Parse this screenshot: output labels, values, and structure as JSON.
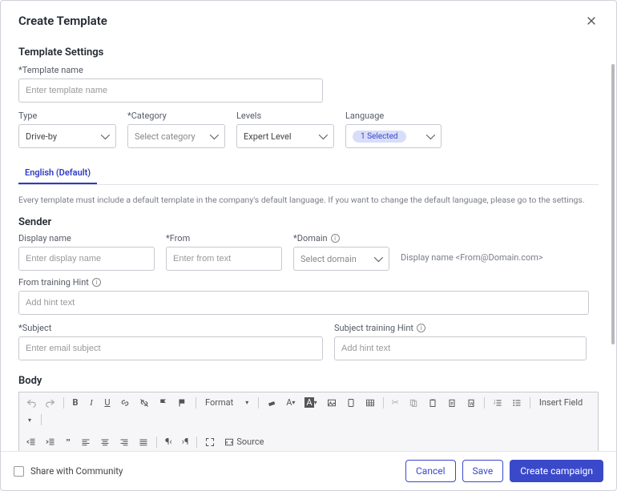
{
  "header": {
    "title": "Create Template"
  },
  "sections": {
    "settings_title": "Template Settings",
    "sender_title": "Sender",
    "body_title": "Body"
  },
  "fields": {
    "template_name": {
      "label": "*Template name",
      "placeholder": "Enter template name"
    },
    "type": {
      "label": "Type",
      "value": "Drive-by"
    },
    "category": {
      "label": "*Category",
      "placeholder": "Select category"
    },
    "levels": {
      "label": "Levels",
      "value": "Expert Level"
    },
    "language": {
      "label": "Language",
      "selected_pill": "1 Selected"
    },
    "display_name": {
      "label": "Display name",
      "placeholder": "Enter display name"
    },
    "from": {
      "label": "*From",
      "placeholder": "Enter from text"
    },
    "domain": {
      "label": "*Domain",
      "placeholder": "Select domain"
    },
    "from_hint": {
      "label": "From training Hint",
      "placeholder": "Add hint text"
    },
    "subject": {
      "label": "*Subject",
      "placeholder": "Enter email subject"
    },
    "subject_hint": {
      "label": "Subject training Hint",
      "placeholder": "Add hint text"
    }
  },
  "tabs": {
    "active": "English (Default)"
  },
  "notes": {
    "default_lang": "Every template must include a default template in the company's default language. If you want to change the default language, please go to the settings.",
    "sender_preview": "Display name <From@Domain.com>"
  },
  "toolbar": {
    "format": "Format",
    "insert_field": "Insert Field",
    "source": "Source"
  },
  "footer": {
    "share": "Share with Community",
    "cancel": "Cancel",
    "save": "Save",
    "create": "Create campaign"
  }
}
